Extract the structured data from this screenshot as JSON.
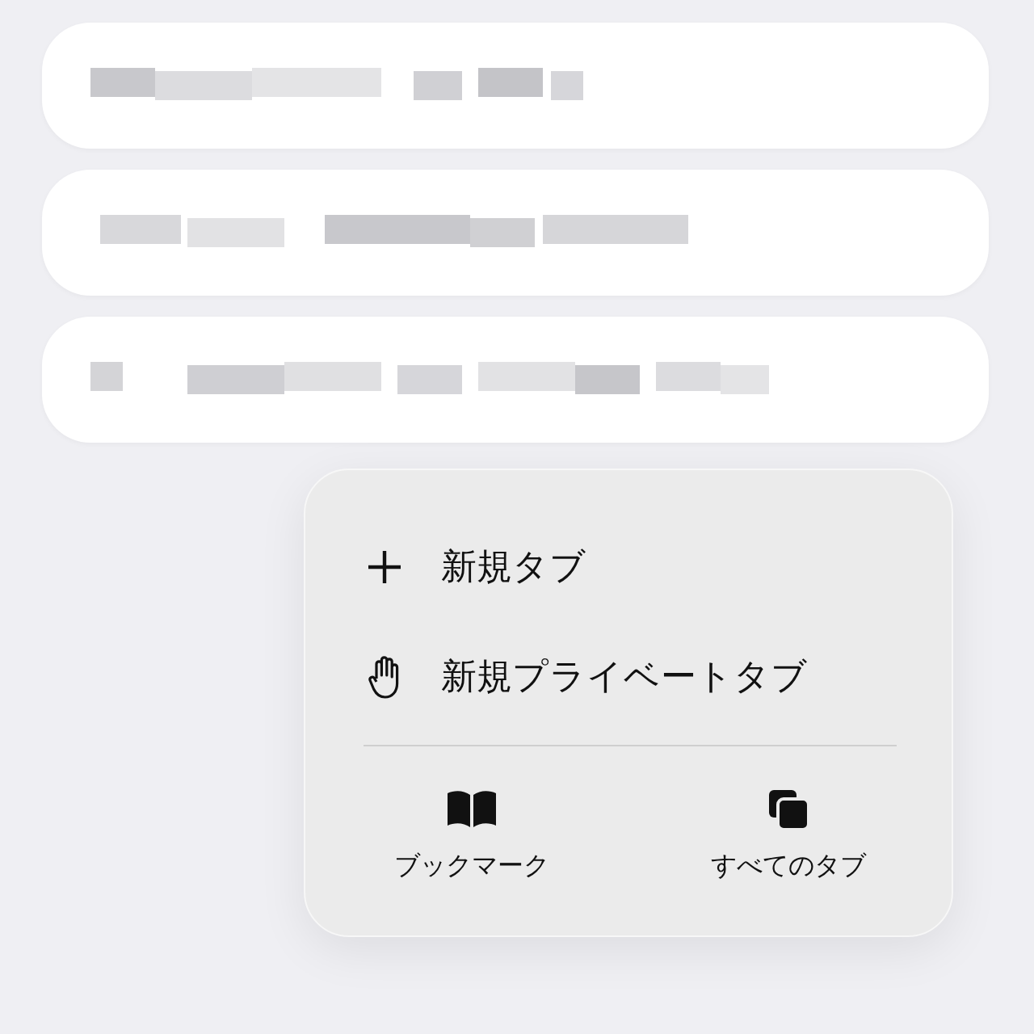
{
  "cards": [
    {
      "kind": "blurred"
    },
    {
      "kind": "blurred"
    },
    {
      "kind": "blurred"
    }
  ],
  "menu": {
    "items": [
      {
        "kind": "plus",
        "label": "新規タブ"
      },
      {
        "kind": "hand",
        "label": "新規プライベートタブ"
      }
    ],
    "buttons": [
      {
        "kind": "book",
        "label": "ブックマーク"
      },
      {
        "kind": "tabs",
        "label": "すべてのタブ"
      }
    ]
  }
}
